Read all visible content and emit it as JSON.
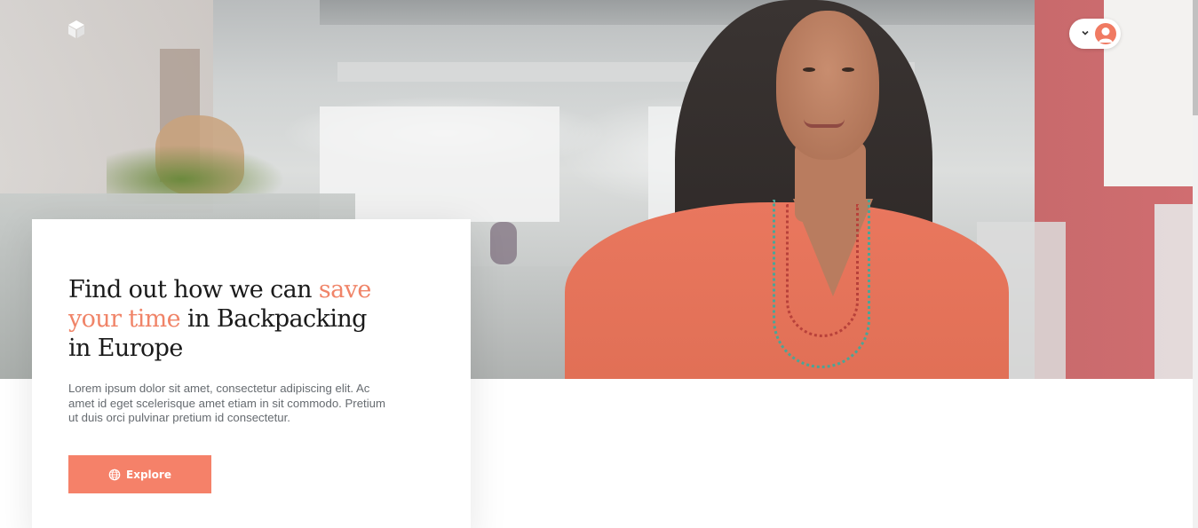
{
  "hero": {
    "image_description": "",
    "accent_color": "#f58169"
  },
  "header": {
    "logo_icon": "cube-icon",
    "user_menu": {
      "chevron_icon": "chevron-down-icon",
      "avatar_icon": "user-avatar-icon"
    }
  },
  "card": {
    "title_part1": "Find out how we can ",
    "title_highlight": "save your time",
    "title_part2": " in Backpacking in Europe",
    "description": "Lorem ipsum dolor sit amet, consectetur adipiscing elit. Ac amet id eget scelerisque amet etiam in sit commodo. Pretium ut duis orci pulvinar pretium id consectetur.",
    "button_label": "Explore",
    "button_icon": "globe-icon"
  }
}
